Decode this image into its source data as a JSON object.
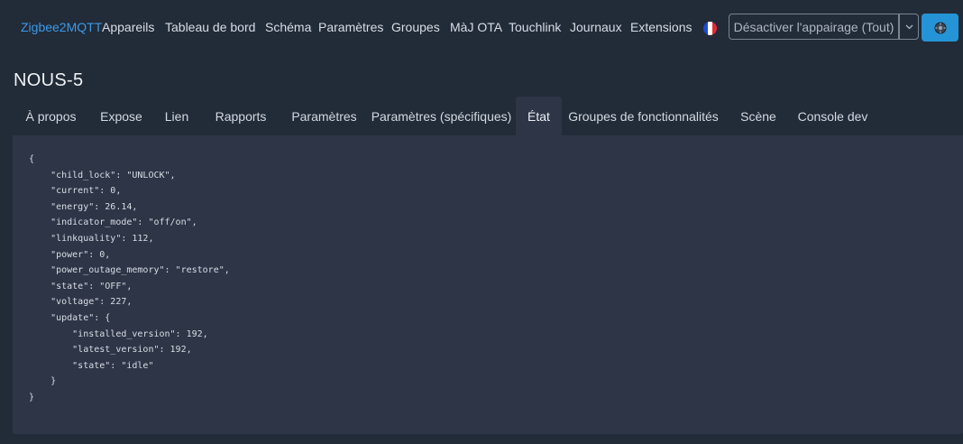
{
  "navbar": {
    "brand": "Zigbee2MQTT",
    "items": [
      "Appareils",
      "Tableau de bord",
      "Schéma",
      "Paramètres",
      "Groupes",
      "MàJ OTA",
      "Touchlink",
      "Journaux",
      "Extensions"
    ],
    "language_flag": "fr-flag-icon",
    "pairing_button_label": "Désactiver l'appairage (Tout)",
    "pairing_dropdown_icon": "chevron-down-icon",
    "settings_icon": "gear-icon"
  },
  "device": {
    "title": "NOUS-5"
  },
  "tabs": [
    "À propos",
    "Expose",
    "Lien",
    "Rapports",
    "Paramètres",
    "Paramètres (spécifiques)",
    "État",
    "Groupes de fonctionnalités",
    "Scène",
    "Console dev"
  ],
  "active_tab": "État",
  "state_json": "{\n    \"child_lock\": \"UNLOCK\",\n    \"current\": 0,\n    \"energy\": 26.14,\n    \"indicator_mode\": \"off/on\",\n    \"linkquality\": 112,\n    \"power\": 0,\n    \"power_outage_memory\": \"restore\",\n    \"state\": \"OFF\",\n    \"voltage\": 227,\n    \"update\": {\n        \"installed_version\": 192,\n        \"latest_version\": 192,\n        \"state\": \"idle\"\n    }\n}",
  "colors": {
    "background": "#222b38",
    "panel": "#2d3547",
    "brand": "#3c9ae8",
    "primary_button": "#2494d6"
  }
}
